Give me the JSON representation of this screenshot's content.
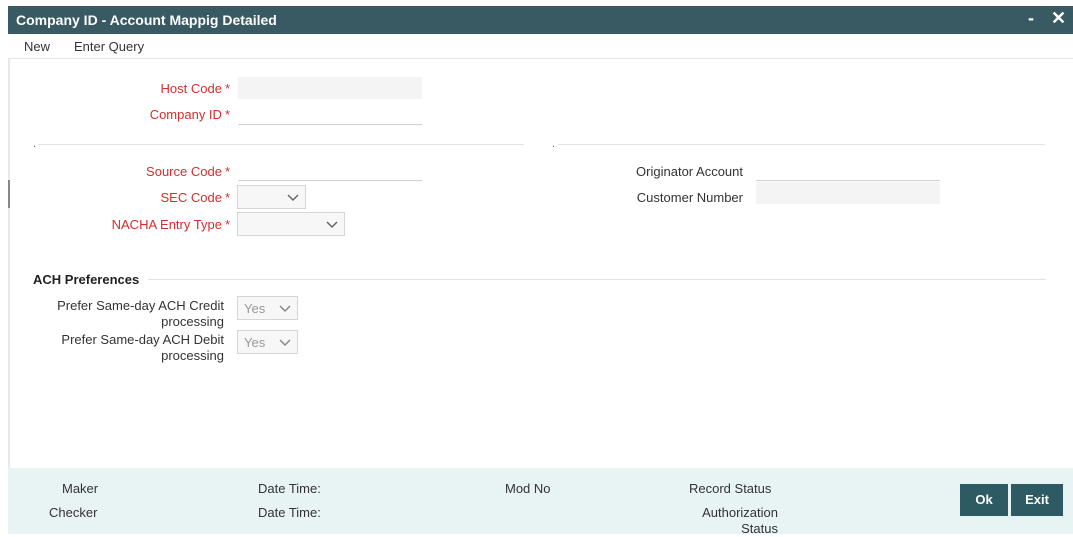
{
  "window": {
    "title": "Company ID - Account Mappig Detailed",
    "minimize": "-",
    "close": "✕"
  },
  "menu": {
    "new": "New",
    "enter_query": "Enter Query"
  },
  "fields": {
    "host_code": {
      "label": "Host Code",
      "required": "*",
      "value": ""
    },
    "company_id": {
      "label": "Company ID",
      "required": "*",
      "value": ""
    },
    "source_code": {
      "label": "Source Code",
      "required": "*",
      "value": ""
    },
    "sec_code": {
      "label": "SEC Code",
      "required": "*",
      "value": ""
    },
    "nacha_entry_type": {
      "label": "NACHA Entry Type",
      "required": "*",
      "value": ""
    },
    "originator_account": {
      "label": "Originator Account",
      "value": ""
    },
    "customer_number": {
      "label": "Customer Number",
      "value": ""
    }
  },
  "ach": {
    "section_title": "ACH Preferences",
    "credit": {
      "label_line1": "Prefer Same-day ACH Credit",
      "label_line2": "processing",
      "value": "Yes"
    },
    "debit": {
      "label_line1": "Prefer Same-day ACH Debit",
      "label_line2": "processing",
      "value": "Yes"
    }
  },
  "footer": {
    "maker": "Maker",
    "checker": "Checker",
    "date_time_1": "Date Time:",
    "date_time_2": "Date Time:",
    "mod_no": "Mod No",
    "record_status": "Record Status",
    "authorization_status_line1": "Authorization",
    "authorization_status_line2": "Status"
  },
  "buttons": {
    "ok": "Ok",
    "exit": "Exit"
  },
  "colors": {
    "titlebar": "#3a5a63",
    "required": "#d12f2f",
    "footer": "#e8f3f4",
    "button": "#2e5a63"
  }
}
